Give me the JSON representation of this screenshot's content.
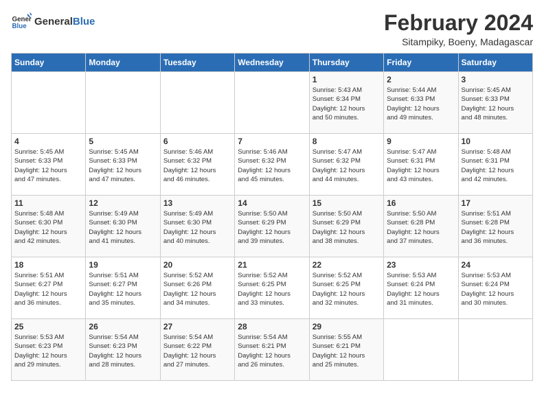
{
  "logo": {
    "general": "General",
    "blue": "Blue"
  },
  "title": "February 2024",
  "subtitle": "Sitampiky, Boeny, Madagascar",
  "days_of_week": [
    "Sunday",
    "Monday",
    "Tuesday",
    "Wednesday",
    "Thursday",
    "Friday",
    "Saturday"
  ],
  "weeks": [
    [
      {
        "day": "",
        "info": ""
      },
      {
        "day": "",
        "info": ""
      },
      {
        "day": "",
        "info": ""
      },
      {
        "day": "",
        "info": ""
      },
      {
        "day": "1",
        "info": "Sunrise: 5:43 AM\nSunset: 6:34 PM\nDaylight: 12 hours\nand 50 minutes."
      },
      {
        "day": "2",
        "info": "Sunrise: 5:44 AM\nSunset: 6:33 PM\nDaylight: 12 hours\nand 49 minutes."
      },
      {
        "day": "3",
        "info": "Sunrise: 5:45 AM\nSunset: 6:33 PM\nDaylight: 12 hours\nand 48 minutes."
      }
    ],
    [
      {
        "day": "4",
        "info": "Sunrise: 5:45 AM\nSunset: 6:33 PM\nDaylight: 12 hours\nand 47 minutes."
      },
      {
        "day": "5",
        "info": "Sunrise: 5:45 AM\nSunset: 6:33 PM\nDaylight: 12 hours\nand 47 minutes."
      },
      {
        "day": "6",
        "info": "Sunrise: 5:46 AM\nSunset: 6:32 PM\nDaylight: 12 hours\nand 46 minutes."
      },
      {
        "day": "7",
        "info": "Sunrise: 5:46 AM\nSunset: 6:32 PM\nDaylight: 12 hours\nand 45 minutes."
      },
      {
        "day": "8",
        "info": "Sunrise: 5:47 AM\nSunset: 6:32 PM\nDaylight: 12 hours\nand 44 minutes."
      },
      {
        "day": "9",
        "info": "Sunrise: 5:47 AM\nSunset: 6:31 PM\nDaylight: 12 hours\nand 43 minutes."
      },
      {
        "day": "10",
        "info": "Sunrise: 5:48 AM\nSunset: 6:31 PM\nDaylight: 12 hours\nand 42 minutes."
      }
    ],
    [
      {
        "day": "11",
        "info": "Sunrise: 5:48 AM\nSunset: 6:30 PM\nDaylight: 12 hours\nand 42 minutes."
      },
      {
        "day": "12",
        "info": "Sunrise: 5:49 AM\nSunset: 6:30 PM\nDaylight: 12 hours\nand 41 minutes."
      },
      {
        "day": "13",
        "info": "Sunrise: 5:49 AM\nSunset: 6:30 PM\nDaylight: 12 hours\nand 40 minutes."
      },
      {
        "day": "14",
        "info": "Sunrise: 5:50 AM\nSunset: 6:29 PM\nDaylight: 12 hours\nand 39 minutes."
      },
      {
        "day": "15",
        "info": "Sunrise: 5:50 AM\nSunset: 6:29 PM\nDaylight: 12 hours\nand 38 minutes."
      },
      {
        "day": "16",
        "info": "Sunrise: 5:50 AM\nSunset: 6:28 PM\nDaylight: 12 hours\nand 37 minutes."
      },
      {
        "day": "17",
        "info": "Sunrise: 5:51 AM\nSunset: 6:28 PM\nDaylight: 12 hours\nand 36 minutes."
      }
    ],
    [
      {
        "day": "18",
        "info": "Sunrise: 5:51 AM\nSunset: 6:27 PM\nDaylight: 12 hours\nand 36 minutes."
      },
      {
        "day": "19",
        "info": "Sunrise: 5:51 AM\nSunset: 6:27 PM\nDaylight: 12 hours\nand 35 minutes."
      },
      {
        "day": "20",
        "info": "Sunrise: 5:52 AM\nSunset: 6:26 PM\nDaylight: 12 hours\nand 34 minutes."
      },
      {
        "day": "21",
        "info": "Sunrise: 5:52 AM\nSunset: 6:25 PM\nDaylight: 12 hours\nand 33 minutes."
      },
      {
        "day": "22",
        "info": "Sunrise: 5:52 AM\nSunset: 6:25 PM\nDaylight: 12 hours\nand 32 minutes."
      },
      {
        "day": "23",
        "info": "Sunrise: 5:53 AM\nSunset: 6:24 PM\nDaylight: 12 hours\nand 31 minutes."
      },
      {
        "day": "24",
        "info": "Sunrise: 5:53 AM\nSunset: 6:24 PM\nDaylight: 12 hours\nand 30 minutes."
      }
    ],
    [
      {
        "day": "25",
        "info": "Sunrise: 5:53 AM\nSunset: 6:23 PM\nDaylight: 12 hours\nand 29 minutes."
      },
      {
        "day": "26",
        "info": "Sunrise: 5:54 AM\nSunset: 6:23 PM\nDaylight: 12 hours\nand 28 minutes."
      },
      {
        "day": "27",
        "info": "Sunrise: 5:54 AM\nSunset: 6:22 PM\nDaylight: 12 hours\nand 27 minutes."
      },
      {
        "day": "28",
        "info": "Sunrise: 5:54 AM\nSunset: 6:21 PM\nDaylight: 12 hours\nand 26 minutes."
      },
      {
        "day": "29",
        "info": "Sunrise: 5:55 AM\nSunset: 6:21 PM\nDaylight: 12 hours\nand 25 minutes."
      },
      {
        "day": "",
        "info": ""
      },
      {
        "day": "",
        "info": ""
      }
    ]
  ]
}
